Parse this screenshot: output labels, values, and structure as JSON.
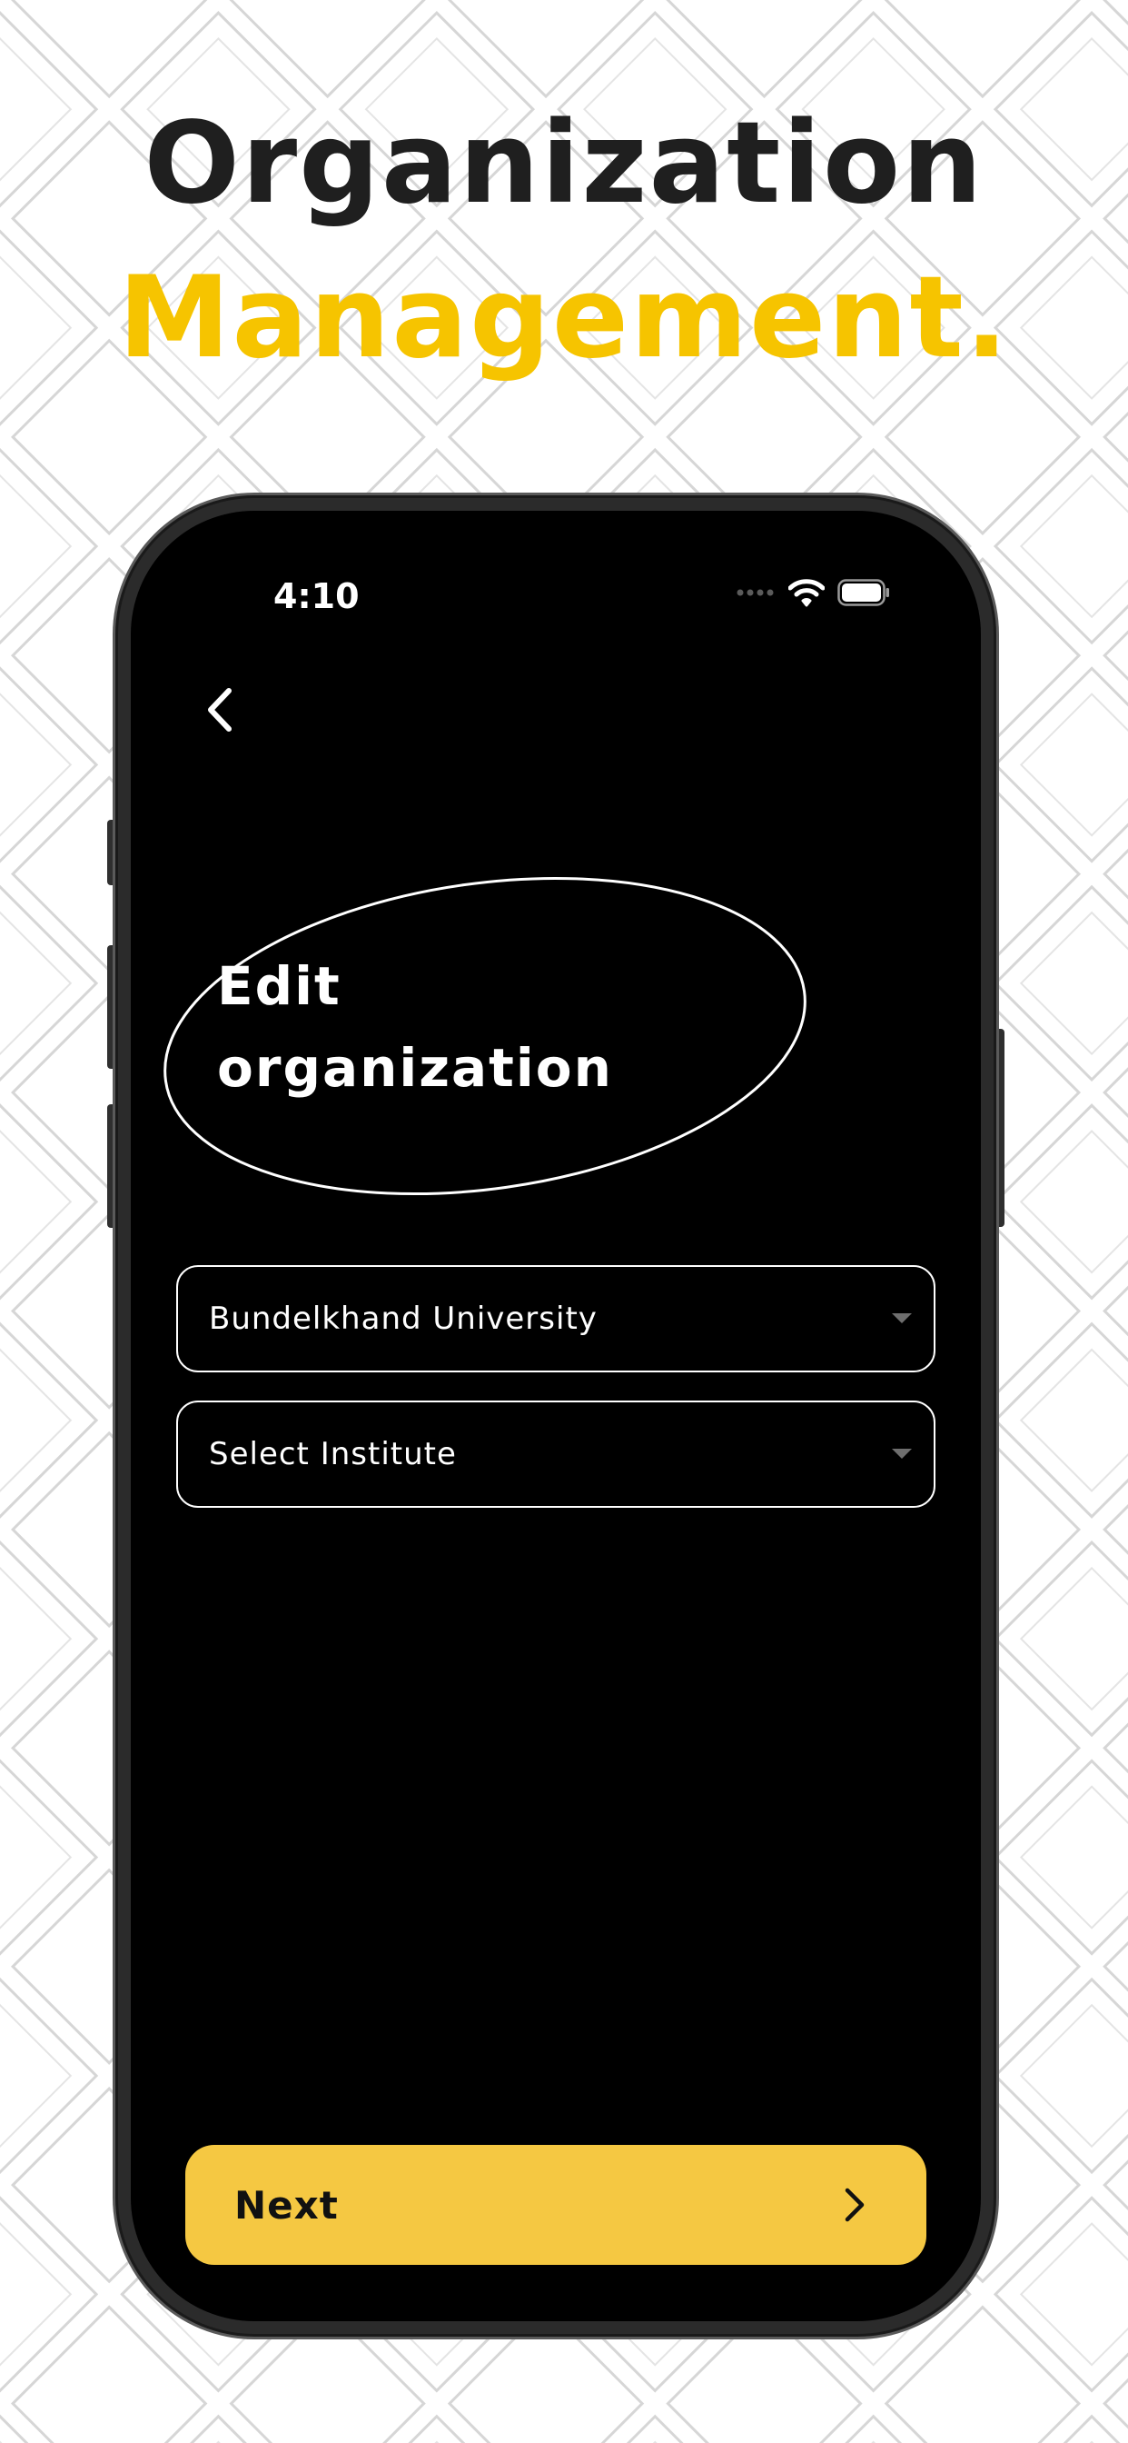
{
  "promo": {
    "headline_line1": "Organization",
    "headline_line2": "Management.",
    "headline_color": "#1f1f1f",
    "accent_color": "#f6c400"
  },
  "status_bar": {
    "time": "4:10",
    "icons": [
      "signal-dots-icon",
      "wifi-icon",
      "battery-icon"
    ]
  },
  "header": {
    "back_icon": "chevron-left-icon",
    "title": "Edit organization"
  },
  "form": {
    "organization_dropdown": {
      "selected": "Bundelkhand University",
      "icon": "caret-down-icon"
    },
    "institute_dropdown": {
      "placeholder": "Select Institute",
      "icon": "caret-down-icon"
    }
  },
  "footer": {
    "next_label": "Next",
    "next_icon": "chevron-right-icon",
    "button_color": "#f5c842"
  }
}
